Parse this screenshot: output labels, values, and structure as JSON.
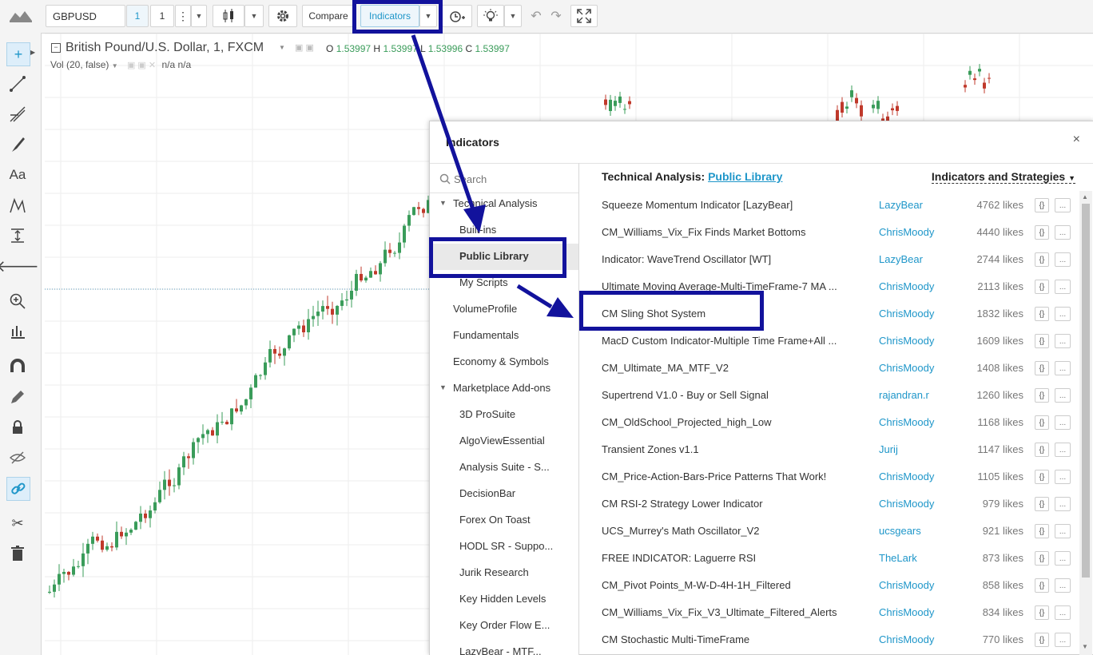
{
  "toolbar": {
    "symbol": "GBPUSD",
    "interval_badge": "1",
    "interval": "1",
    "compare_label": "Compare",
    "indicators_label": "Indicators"
  },
  "chart": {
    "title": "British Pound/U.S. Dollar, 1, FXCM",
    "ohlc": {
      "o_label": "O",
      "o": "1.53997",
      "h_label": "H",
      "h": "1.53997",
      "l_label": "L",
      "l": "1.53996",
      "c_label": "C",
      "c": "1.53997"
    },
    "vol_label": "Vol (20, false)",
    "vol_values": "n/a  n/a",
    "up_color": "#3a9c5a",
    "down_color": "#c0392b"
  },
  "modal": {
    "title": "Indicators",
    "close_label": "×",
    "search_placeholder": "Search",
    "header_section": "Technical Analysis:",
    "header_link": "Public Library",
    "header_dropdown": "Indicators and Strategies",
    "left_items": [
      {
        "label": "Technical Analysis",
        "level": 0,
        "expand": true
      },
      {
        "label": "Built-ins",
        "level": 1
      },
      {
        "label": "Public Library",
        "level": 1,
        "selected": true
      },
      {
        "label": "My Scripts",
        "level": 1
      },
      {
        "label": "VolumeProfile",
        "level": 0
      },
      {
        "label": "Fundamentals",
        "level": 0
      },
      {
        "label": "Economy & Symbols",
        "level": 0
      },
      {
        "label": "Marketplace Add-ons",
        "level": 0,
        "expand": true
      },
      {
        "label": "3D ProSuite",
        "level": 1
      },
      {
        "label": "AlgoViewEssential",
        "level": 1
      },
      {
        "label": "Analysis Suite - S...",
        "level": 1
      },
      {
        "label": "DecisionBar",
        "level": 1
      },
      {
        "label": "Forex On Toast",
        "level": 1
      },
      {
        "label": "HODL SR - Suppo...",
        "level": 1
      },
      {
        "label": "Jurik Research",
        "level": 1
      },
      {
        "label": "Key Hidden Levels",
        "level": 1
      },
      {
        "label": "Key Order Flow E...",
        "level": 1
      },
      {
        "label": "LazyBear - MTF...",
        "level": 1
      }
    ],
    "rows": [
      {
        "name": "Squeeze Momentum Indicator [LazyBear]",
        "author": "LazyBear",
        "likes": "4762 likes"
      },
      {
        "name": "CM_Williams_Vix_Fix Finds Market Bottoms",
        "author": "ChrisMoody",
        "likes": "4440 likes"
      },
      {
        "name": "Indicator: WaveTrend Oscillator [WT]",
        "author": "LazyBear",
        "likes": "2744 likes"
      },
      {
        "name": "Ultimate Moving Average-Multi-TimeFrame-7 MA ...",
        "author": "ChrisMoody",
        "likes": "2113 likes"
      },
      {
        "name": "CM Sling Shot System",
        "author": "ChrisMoody",
        "likes": "1832 likes"
      },
      {
        "name": "MacD Custom Indicator-Multiple Time Frame+All ...",
        "author": "ChrisMoody",
        "likes": "1609 likes"
      },
      {
        "name": "CM_Ultimate_MA_MTF_V2",
        "author": "ChrisMoody",
        "likes": "1408 likes"
      },
      {
        "name": "Supertrend V1.0 - Buy or Sell Signal",
        "author": "rajandran.r",
        "likes": "1260 likes"
      },
      {
        "name": "CM_OldSchool_Projected_high_Low",
        "author": "ChrisMoody",
        "likes": "1168 likes"
      },
      {
        "name": "Transient Zones v1.1",
        "author": "Jurij",
        "likes": "1147 likes"
      },
      {
        "name": "CM_Price-Action-Bars-Price Patterns That Work!",
        "author": "ChrisMoody",
        "likes": "1105 likes"
      },
      {
        "name": "CM RSI-2 Strategy Lower Indicator",
        "author": "ChrisMoody",
        "likes": "979 likes"
      },
      {
        "name": "UCS_Murrey's Math Oscillator_V2",
        "author": "ucsgears",
        "likes": "921 likes"
      },
      {
        "name": "FREE INDICATOR: Laguerre RSI",
        "author": "TheLark",
        "likes": "873 likes"
      },
      {
        "name": "CM_Pivot Points_M-W-D-4H-1H_Filtered",
        "author": "ChrisMoody",
        "likes": "858 likes"
      },
      {
        "name": "CM_Williams_Vix_Fix_V3_Ultimate_Filtered_Alerts",
        "author": "ChrisMoody",
        "likes": "834 likes"
      },
      {
        "name": "CM Stochastic Multi-TimeFrame",
        "author": "ChrisMoody",
        "likes": "770 likes"
      }
    ],
    "row_source_glyph": "{}",
    "row_more_glyph": "..."
  },
  "annotation_color": "#12129c"
}
